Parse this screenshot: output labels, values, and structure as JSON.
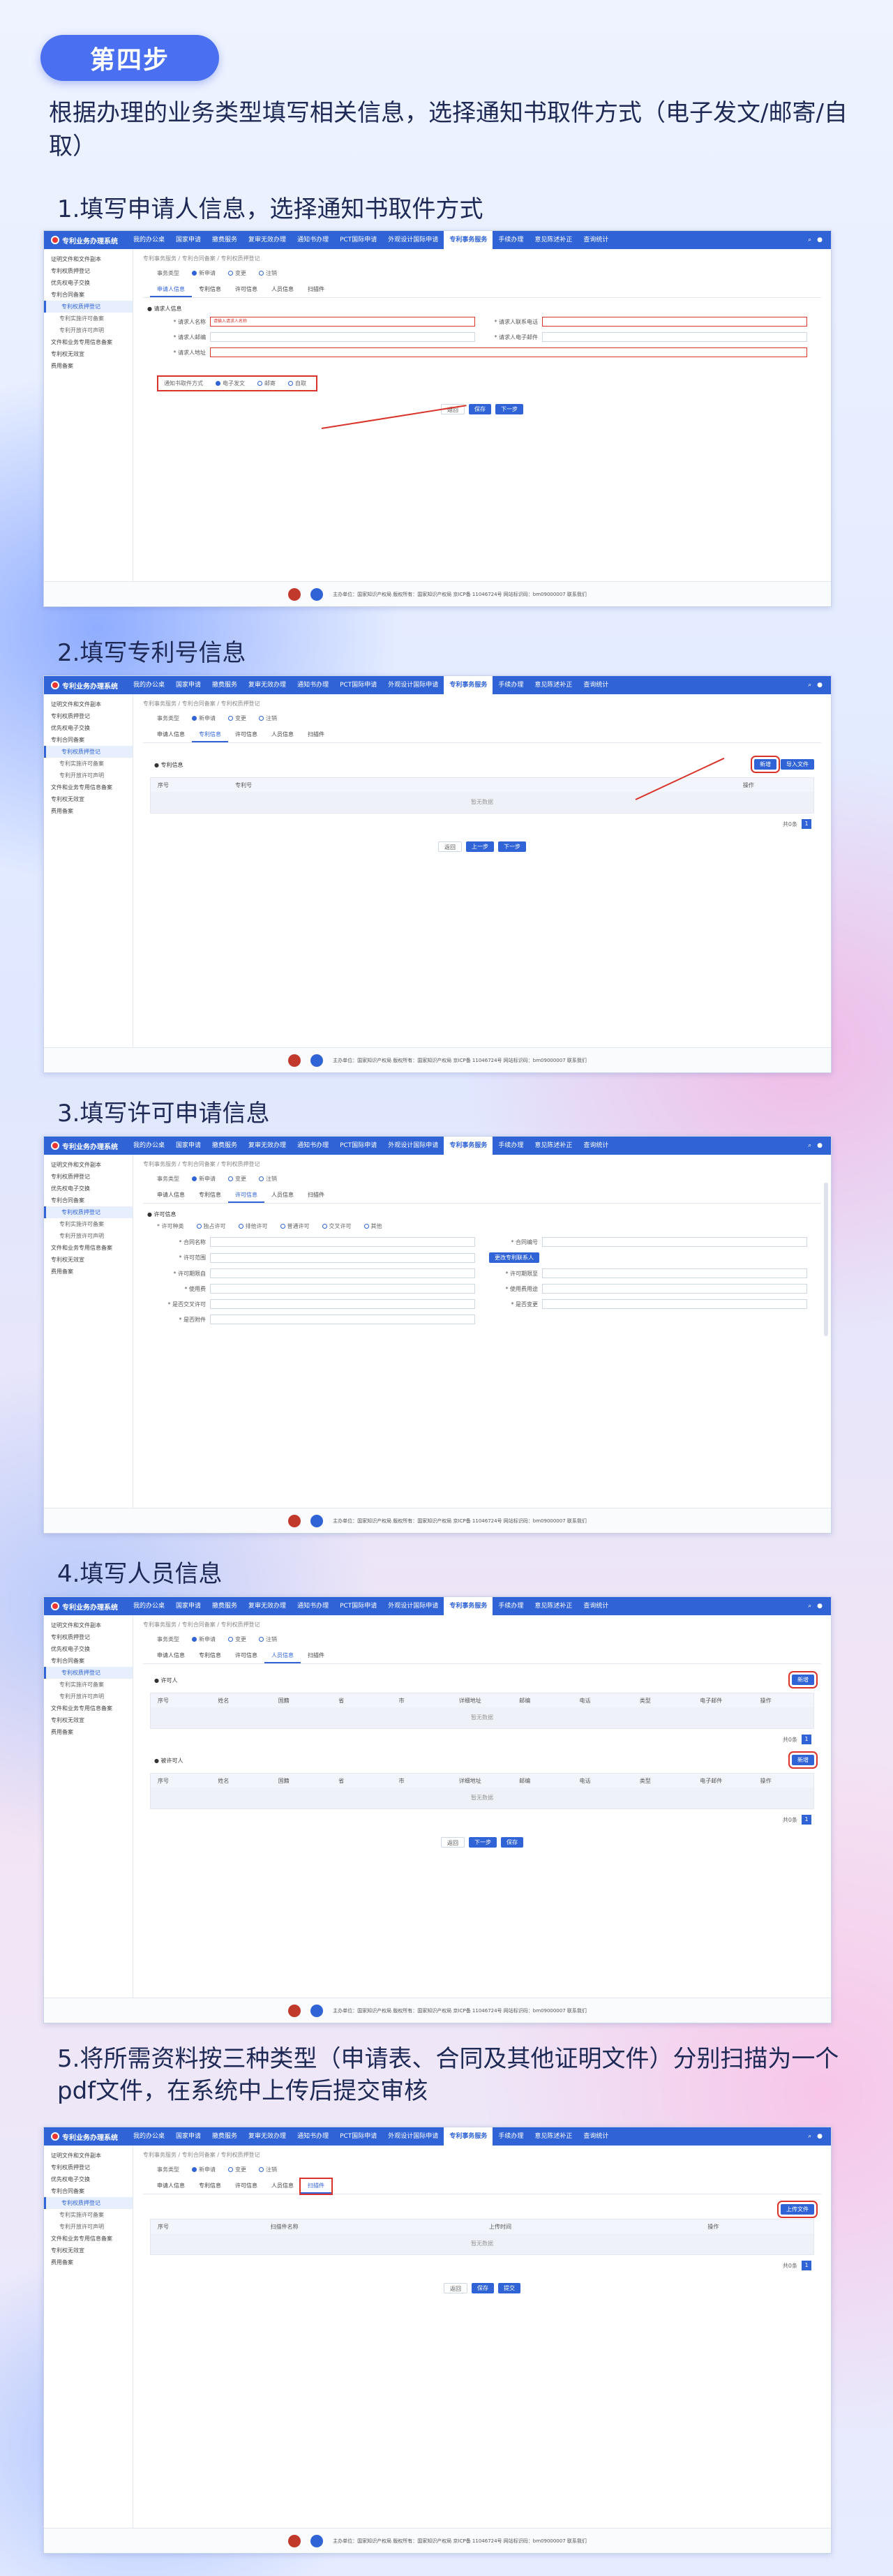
{
  "step_badge": "第四步",
  "intro": "根据办理的业务类型填写相关信息，选择通知书取件方式（电子发文/邮寄/自取）",
  "sections": {
    "s1": "1.填写申请人信息，选择通知书取件方式",
    "s2": "2.填写专利号信息",
    "s3": "3.填写许可申请信息",
    "s4": "4.填写人员信息",
    "s5": "5.将所需资料按三种类型（申请表、合同及其他证明文件）分别扫描为一个pdf文件，在系统中上传后提交审核"
  },
  "app": {
    "brand": "专利业务办理系统",
    "nav": [
      "我的办公桌",
      "国家申请",
      "撤费服务",
      "复审无效办理",
      "通知书办理",
      "PCT国际申请",
      "外观设计国际申请",
      "专利事务服务",
      "手续办理",
      "意见陈述补正",
      "查询统计"
    ],
    "active_nav": "专利事务服务",
    "side": [
      "证明文件和文件副本",
      "专利权质押登记",
      "优先权电子交换",
      "专利合同备案",
      "专利权质押登记",
      "专利实施许可备案",
      "专利开放许可声明",
      "文件和业务专用信息备案",
      "专利权无效宣",
      "费用备案"
    ],
    "crumb": "专利事务服务 / 专利合同备案 / 专利权质押登记",
    "row_label": "事务类型",
    "row_opts": [
      "新申请",
      "变更",
      "注销"
    ],
    "tabs": [
      "申请人信息",
      "专利信息",
      "许可信息",
      "人员信息",
      "扫描件"
    ],
    "footer": "主办单位：国家知识产权局  版权所有：国家知识产权局  京ICP备 11046724号  网站标识码：bm09000007  联系我们"
  },
  "s1": {
    "subhdr": "● 请求人信息",
    "fields": [
      "* 请求人名称",
      "* 请求人联系电话",
      "* 请求人邮编",
      "* 请求人电子邮件",
      "* 请求人地址"
    ],
    "hint": "请输入请求人名称",
    "pickup_label": "通知书取件方式",
    "pickup": [
      "电子发文",
      "邮寄",
      "自取"
    ],
    "btns": [
      "返回",
      "保存",
      "下一步"
    ]
  },
  "s2": {
    "subhdr": "● 专利信息",
    "cols": [
      "序号",
      "专利号",
      "操作"
    ],
    "empty": "暂无数据",
    "add": "新增",
    "import": "导入文件",
    "pager": "共0条",
    "btns": [
      "返回",
      "上一步",
      "下一步"
    ]
  },
  "s3": {
    "subhdr": "● 许可信息",
    "fields": [
      "* 合同名称",
      "* 合同编号",
      "* 许可种类",
      "* 许可范围",
      "* 是否交叉许可",
      "* 许可期限自",
      "* 许可期限至",
      "* 使用费",
      "* 使用费用途",
      "* 是否变更",
      "* 是否附件"
    ],
    "kinds": [
      "独占许可",
      "排他许可",
      "普通许可",
      "交叉许可",
      "其他"
    ],
    "edit": "更改专利联系人"
  },
  "s4": {
    "subhdr1": "● 许可人",
    "subhdr2": "● 被许可人",
    "cols": [
      "序号",
      "姓名",
      "国籍",
      "省",
      "市",
      "详细地址",
      "邮编",
      "电话",
      "类型",
      "电子邮件",
      "操作"
    ],
    "empty": "暂无数据",
    "add": "新增",
    "pager": "共0条",
    "btns": [
      "返回",
      "下一步",
      "保存"
    ]
  },
  "s5": {
    "cols": [
      "序号",
      "扫描件名称",
      "上传时间",
      "操作"
    ],
    "empty": "暂无数据",
    "upload": "上传文件",
    "pager": "共0条",
    "btns": [
      "返回",
      "保存",
      "提交"
    ]
  }
}
